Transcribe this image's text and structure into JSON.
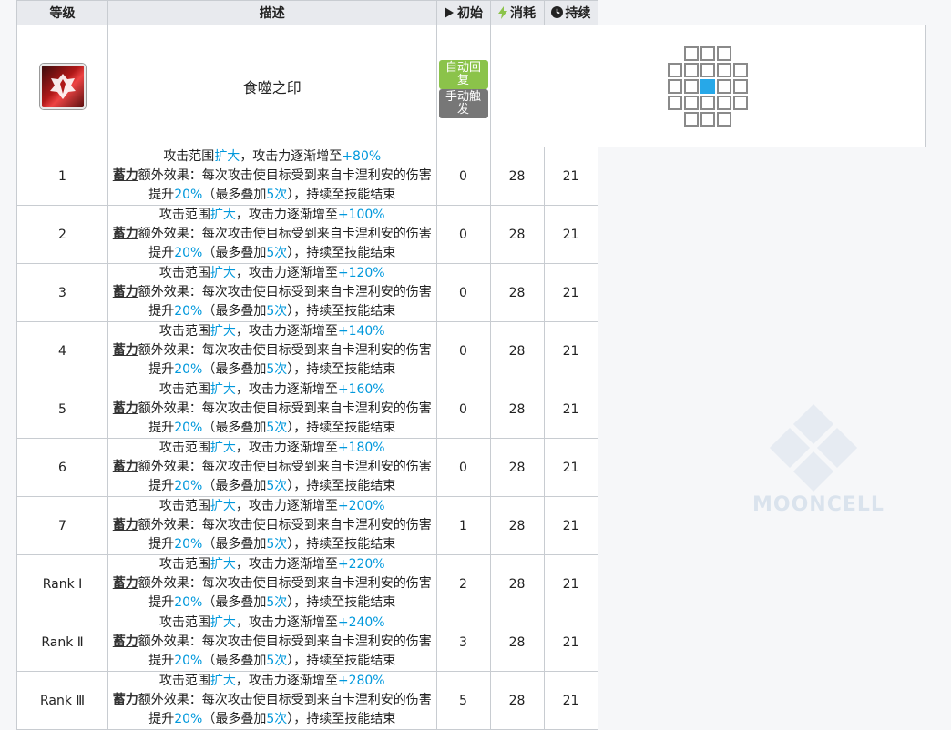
{
  "skill": {
    "name": "食噬之印",
    "tags": [
      {
        "label": "自动回复",
        "color": "#8bc34a"
      },
      {
        "label": "手动触发",
        "color": "#777777"
      }
    ]
  },
  "headers": {
    "level": "等级",
    "desc": "描述",
    "init": "初始",
    "cost": "消耗",
    "duration": "持续"
  },
  "desc_template": {
    "p1": "攻击范围",
    "range_word": "扩大",
    "p2": "，攻击力逐渐增至",
    "keyword": "蓄力",
    "line2_a": "额外效果：每次攻击使目标受到来自卡涅利安的伤害提升",
    "pct": "20%",
    "line2_b": "（最多叠加",
    "stack": "5次",
    "line2_c": "），持续至技能结束"
  },
  "rows": [
    {
      "level": "1",
      "atk": "+80%",
      "init": "0",
      "cost": "28",
      "duration": "21"
    },
    {
      "level": "2",
      "atk": "+100%",
      "init": "0",
      "cost": "28",
      "duration": "21"
    },
    {
      "level": "3",
      "atk": "+120%",
      "init": "0",
      "cost": "28",
      "duration": "21"
    },
    {
      "level": "4",
      "atk": "+140%",
      "init": "0",
      "cost": "28",
      "duration": "21"
    },
    {
      "level": "5",
      "atk": "+160%",
      "init": "0",
      "cost": "28",
      "duration": "21"
    },
    {
      "level": "6",
      "atk": "+180%",
      "init": "0",
      "cost": "28",
      "duration": "21"
    },
    {
      "level": "7",
      "atk": "+200%",
      "init": "1",
      "cost": "28",
      "duration": "21"
    },
    {
      "level": "Rank Ⅰ",
      "atk": "+220%",
      "init": "2",
      "cost": "28",
      "duration": "21"
    },
    {
      "level": "Rank Ⅱ",
      "atk": "+240%",
      "init": "3",
      "cost": "28",
      "duration": "21"
    },
    {
      "level": "Rank Ⅲ",
      "atk": "+280%",
      "init": "5",
      "cost": "28",
      "duration": "21"
    }
  ],
  "watermark": "MOONCELL",
  "icons": {
    "skill": "dragon-crest-icon",
    "init": "play-icon",
    "cost": "lightning-icon",
    "duration": "clock-icon"
  },
  "colors": {
    "highlight": "#0098dc",
    "range_self": "#27a8e8",
    "lightning": "#8bc34a"
  }
}
